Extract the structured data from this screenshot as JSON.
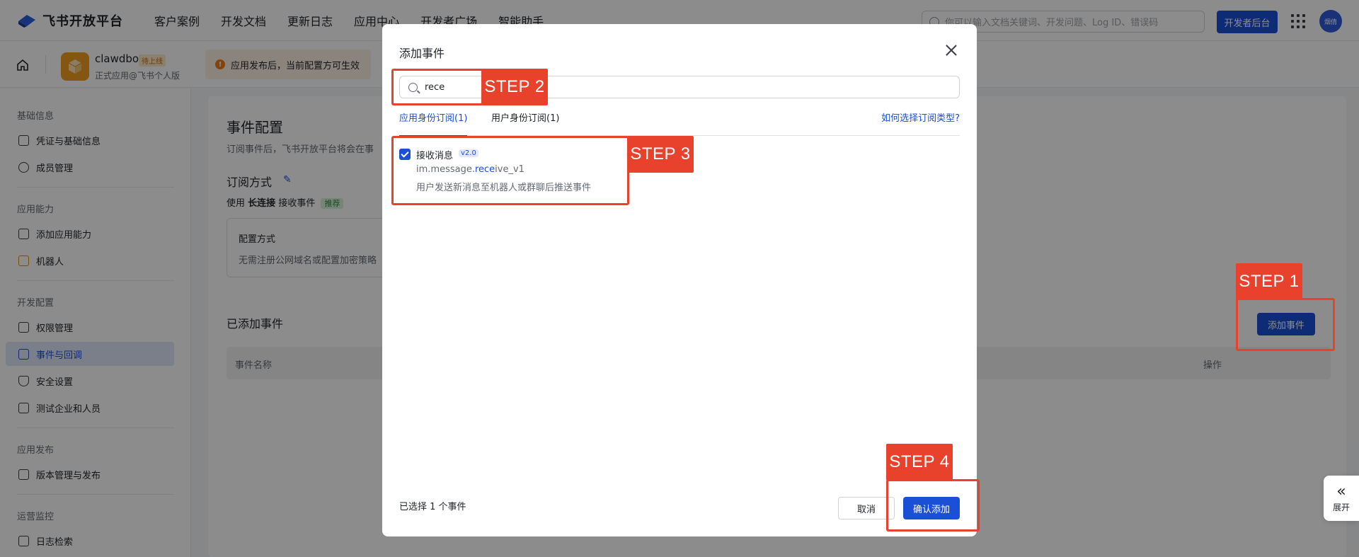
{
  "topnav": {
    "brand": "飞书开放平台",
    "links": [
      "客户案例",
      "开发文档",
      "更新日志",
      "应用中心",
      "开发者广场",
      "智能助手"
    ],
    "search_placeholder": "你可以输入文档关键词、开发问题、Log ID、错误码",
    "dev_console": "开发者后台",
    "avatar_text": "烟倩"
  },
  "app": {
    "name": "clawdbot",
    "badge": "待上线",
    "subtitle": "正式应用@飞书个人版",
    "notice": "应用发布后，当前配置方可生效"
  },
  "sidebar": {
    "groups": [
      {
        "title": "基础信息",
        "items": [
          "凭证与基础信息",
          "成员管理"
        ]
      },
      {
        "title": "应用能力",
        "items": [
          "添加应用能力",
          "机器人"
        ]
      },
      {
        "title": "开发配置",
        "items": [
          "权限管理",
          "事件与回调",
          "安全设置",
          "测试企业和人员"
        ]
      },
      {
        "title": "应用发布",
        "items": [
          "版本管理与发布"
        ]
      },
      {
        "title": "运营监控",
        "items": [
          "日志检索"
        ]
      }
    ],
    "active": "事件与回调"
  },
  "main": {
    "title": "事件配置",
    "desc": "订阅事件后，飞书开放平台将会在事",
    "sub_title": "订阅方式",
    "sub_line_prefix": "使用",
    "sub_line_bold": "长连接",
    "sub_line_suffix": "接收事件",
    "recommend_tag": "推荐",
    "cfg_title": "配置方式",
    "cfg_desc": "无需注册公网域名或配置加密策略",
    "added_title": "已添加事件",
    "add_event_btn": "添加事件",
    "col_name": "事件名称",
    "col_op": "操作"
  },
  "modal": {
    "title": "添加事件",
    "search_value": "rece",
    "tabs": [
      "应用身份订阅(1)",
      "用户身份订阅(1)"
    ],
    "help_link": "如何选择订阅类型?",
    "event": {
      "name": "接收消息",
      "version": "v2.0",
      "code_before": "im.message.",
      "code_highlight": "rece",
      "code_after": "ive_v1",
      "desc": "用户发送新消息至机器人或群聊后推送事件",
      "checked": true
    },
    "selected_count": "已选择 1 个事件",
    "cancel": "取消",
    "confirm": "确认添加"
  },
  "steps": [
    "STEP 1",
    "STEP 2",
    "STEP 3",
    "STEP 4"
  ],
  "expand_label": "展开",
  "colors": {
    "accent": "#1a4fd6",
    "annotation": "#e8422d"
  }
}
